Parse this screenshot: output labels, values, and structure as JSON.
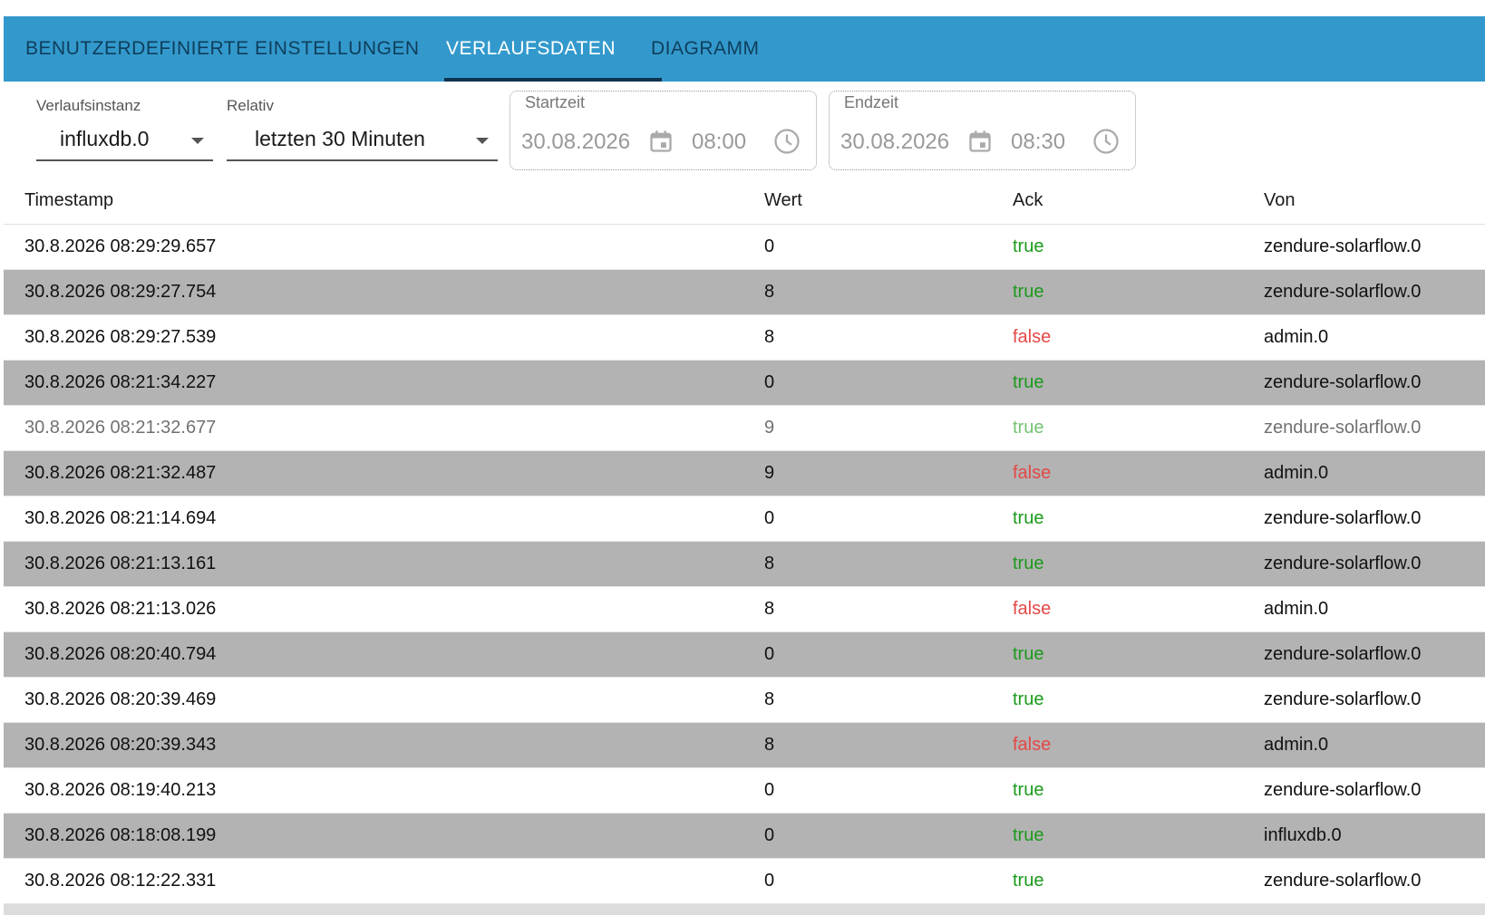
{
  "tabs": [
    {
      "label": "BENUTZERDEFINIERTE EINSTELLUNGEN",
      "active": false
    },
    {
      "label": "VERLAUFSDATEN",
      "active": true
    },
    {
      "label": "DIAGRAMM",
      "active": false
    }
  ],
  "controls": {
    "instance": {
      "label": "Verlaufsinstanz",
      "value": "influxdb.0"
    },
    "relative": {
      "label": "Relativ",
      "value": "letzten 30 Minuten"
    },
    "start": {
      "label": "Startzeit",
      "date": "30.08.2026",
      "time": "08:00"
    },
    "end": {
      "label": "Endzeit",
      "date": "30.08.2026",
      "time": "08:30"
    }
  },
  "table": {
    "headers": {
      "ts": "Timestamp",
      "val": "Wert",
      "ack": "Ack",
      "from": "Von"
    },
    "rows": [
      {
        "ts": "30.8.2026 08:29:29.657",
        "val": "0",
        "ack": "true",
        "from": "zendure-solarflow.0"
      },
      {
        "ts": "30.8.2026 08:29:27.754",
        "val": "8",
        "ack": "true",
        "from": "zendure-solarflow.0"
      },
      {
        "ts": "30.8.2026 08:29:27.539",
        "val": "8",
        "ack": "false",
        "from": "admin.0"
      },
      {
        "ts": "30.8.2026 08:21:34.227",
        "val": "0",
        "ack": "true",
        "from": "zendure-solarflow.0"
      },
      {
        "ts": "30.8.2026 08:21:32.677",
        "val": "9",
        "ack": "true",
        "from": "zendure-solarflow.0"
      },
      {
        "ts": "30.8.2026 08:21:32.487",
        "val": "9",
        "ack": "false",
        "from": "admin.0"
      },
      {
        "ts": "30.8.2026 08:21:14.694",
        "val": "0",
        "ack": "true",
        "from": "zendure-solarflow.0"
      },
      {
        "ts": "30.8.2026 08:21:13.161",
        "val": "8",
        "ack": "true",
        "from": "zendure-solarflow.0"
      },
      {
        "ts": "30.8.2026 08:21:13.026",
        "val": "8",
        "ack": "false",
        "from": "admin.0"
      },
      {
        "ts": "30.8.2026 08:20:40.794",
        "val": "0",
        "ack": "true",
        "from": "zendure-solarflow.0"
      },
      {
        "ts": "30.8.2026 08:20:39.469",
        "val": "8",
        "ack": "true",
        "from": "zendure-solarflow.0"
      },
      {
        "ts": "30.8.2026 08:20:39.343",
        "val": "8",
        "ack": "false",
        "from": "admin.0"
      },
      {
        "ts": "30.8.2026 08:19:40.213",
        "val": "0",
        "ack": "true",
        "from": "zendure-solarflow.0"
      },
      {
        "ts": "30.8.2026 08:18:08.199",
        "val": "0",
        "ack": "true",
        "from": "influxdb.0"
      },
      {
        "ts": "30.8.2026 08:12:22.331",
        "val": "0",
        "ack": "true",
        "from": "zendure-solarflow.0"
      }
    ]
  },
  "colors": {
    "tabbar": "#3399cc",
    "ack_true": "#1a9a1a",
    "ack_false": "#e54848",
    "row_alt": "#b3b3b3"
  },
  "icons": {
    "start_date": "calendar-icon",
    "start_time": "clock-icon",
    "end_date": "calendar-icon",
    "end_time": "clock-icon",
    "dropdown": "chevron-down-icon"
  }
}
